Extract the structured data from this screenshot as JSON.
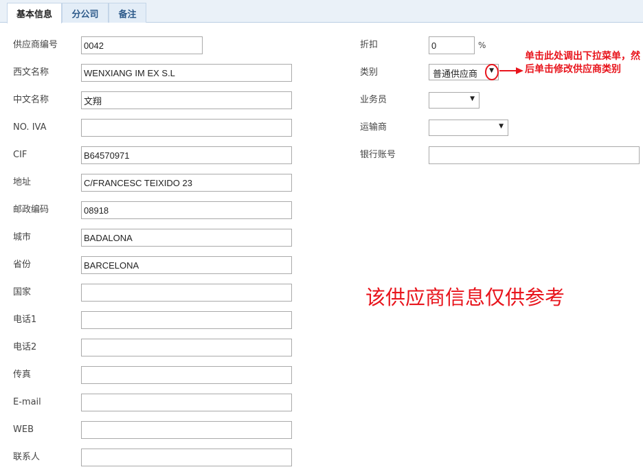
{
  "tabs": [
    {
      "label": "基本信息"
    },
    {
      "label": "分公司"
    },
    {
      "label": "备注"
    }
  ],
  "left_fields": [
    {
      "label": "供应商编号",
      "value": "0042"
    },
    {
      "label": "西文名称",
      "value": "WENXIANG IM EX S.L"
    },
    {
      "label": "中文名称",
      "value": "文翔"
    },
    {
      "label": "NO. IVA",
      "value": ""
    },
    {
      "label": "CIF",
      "value": "B64570971"
    },
    {
      "label": "地址",
      "value": "C/FRANCESC TEIXIDO 23"
    },
    {
      "label": "邮政编码",
      "value": "08918"
    },
    {
      "label": "城市",
      "value": "BADALONA"
    },
    {
      "label": "省份",
      "value": "BARCELONA"
    },
    {
      "label": "国家",
      "value": ""
    },
    {
      "label": "电话1",
      "value": ""
    },
    {
      "label": "电话2",
      "value": ""
    },
    {
      "label": "传真",
      "value": ""
    },
    {
      "label": "E-mail",
      "value": ""
    },
    {
      "label": "WEB",
      "value": ""
    },
    {
      "label": "联系人",
      "value": ""
    }
  ],
  "right_fields": {
    "discount": {
      "label": "折扣",
      "value": "0",
      "unit": "%"
    },
    "category": {
      "label": "类别",
      "value": "普通供应商"
    },
    "salesperson": {
      "label": "业务员",
      "value": ""
    },
    "carrier": {
      "label": "运输商",
      "value": ""
    },
    "bank_account": {
      "label": "银行账号",
      "value": ""
    }
  },
  "annotation": {
    "note": "单击此处调出下拉菜单，然后单击修改供应商类别",
    "watermark": "该供应商信息仅供参考",
    "color": "#e8141c"
  }
}
